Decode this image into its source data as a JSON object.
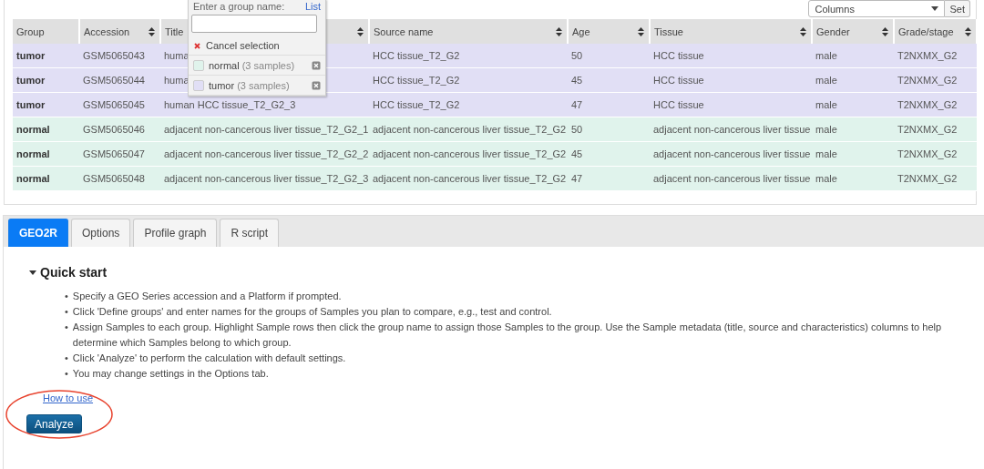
{
  "columns_select": {
    "value": "Columns",
    "button": "Set"
  },
  "table": {
    "columns": [
      {
        "label": "Group",
        "sortable": false
      },
      {
        "label": "Accession",
        "sortable": true
      },
      {
        "label": "Title",
        "sortable": true
      },
      {
        "label": "Source name",
        "sortable": true
      },
      {
        "label": "Age",
        "sortable": true
      },
      {
        "label": "Tissue",
        "sortable": true
      },
      {
        "label": "Gender",
        "sortable": true
      },
      {
        "label": "Grade/stage",
        "sortable": true
      }
    ],
    "rows": [
      {
        "color": "#e1dff5",
        "cells": [
          "tumor",
          "GSM5065043",
          "huma",
          "HCC tissue_T2_G2",
          "50",
          "HCC tissue",
          "male",
          "T2NXMX_G2"
        ]
      },
      {
        "color": "#e1dff5",
        "cells": [
          "tumor",
          "GSM5065044",
          "huma",
          "HCC tissue_T2_G2",
          "45",
          "HCC tissue",
          "male",
          "T2NXMX_G2"
        ]
      },
      {
        "color": "#e1dff5",
        "cells": [
          "tumor",
          "GSM5065045",
          "human HCC tissue_T2_G2_3",
          "HCC tissue_T2_G2",
          "47",
          "HCC tissue",
          "male",
          "T2NXMX_G2"
        ]
      },
      {
        "color": "#e0f3ec",
        "cells": [
          "normal",
          "GSM5065046",
          "adjacent non-cancerous liver tissue_T2_G2_1",
          "adjacent non-cancerous liver tissue_T2_G2",
          "50",
          "adjacent non-cancerous liver tissue",
          "male",
          "T2NXMX_G2"
        ]
      },
      {
        "color": "#e0f3ec",
        "cells": [
          "normal",
          "GSM5065047",
          "adjacent non-cancerous liver tissue_T2_G2_2",
          "adjacent non-cancerous liver tissue_T2_G2",
          "45",
          "adjacent non-cancerous liver tissue",
          "male",
          "T2NXMX_G2"
        ]
      },
      {
        "color": "#e0f3ec",
        "cells": [
          "normal",
          "GSM5065048",
          "adjacent non-cancerous liver tissue_T2_G2_3",
          "adjacent non-cancerous liver tissue_T2_G2",
          "47",
          "adjacent non-cancerous liver tissue",
          "male",
          "T2NXMX_G2"
        ]
      }
    ]
  },
  "group_popup": {
    "prompt": "Enter a group name:",
    "link": "List",
    "cancel": "Cancel selection",
    "groups": [
      {
        "name": "normal",
        "count": "(3 samples)",
        "color": "#e0f3ec"
      },
      {
        "name": "tumor",
        "count": "(3 samples)",
        "color": "#e1dff5"
      }
    ]
  },
  "tabs": [
    {
      "label": "GEO2R",
      "selected": true
    },
    {
      "label": "Options",
      "selected": false
    },
    {
      "label": "Profile graph",
      "selected": false
    },
    {
      "label": "R script",
      "selected": false
    }
  ],
  "quick_start": {
    "title": "Quick start",
    "expanded": true,
    "items": [
      {
        "marker": "•",
        "text": "Specify a GEO Series accession and a Platform if prompted."
      },
      {
        "marker": "•",
        "text": "Click 'Define groups' and enter names for the groups of Samples you plan to compare, e.g., test and control."
      },
      {
        "marker": "•",
        "text": "Assign Samples to each group. Highlight Sample rows then click the group name to assign those Samples to the group. Use the Sample metadata (title, source and characteristics) columns to help determine which Samples belong to which group."
      },
      {
        "marker": "•",
        "text": "Click 'Analyze' to perform the calculation with default settings."
      },
      {
        "marker": "•",
        "text": "You may change settings in the Options tab."
      }
    ],
    "link": "How to use"
  },
  "analyze_button": {
    "label": "Analyze",
    "highlighted": true
  }
}
